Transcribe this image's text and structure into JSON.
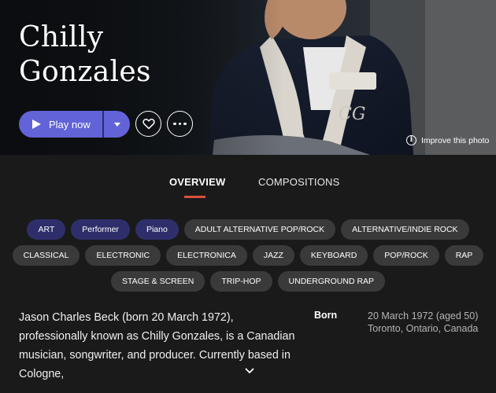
{
  "artist": {
    "name_line1": "Chilly",
    "name_line2": "Gonzales"
  },
  "actions": {
    "play_label": "Play now",
    "improve_photo": "Improve this photo"
  },
  "tabs": [
    {
      "label": "OVERVIEW",
      "active": true
    },
    {
      "label": "COMPOSITIONS",
      "active": false
    }
  ],
  "tags": {
    "row1": [
      "ART",
      "Performer",
      "Piano",
      "ADULT ALTERNATIVE POP/ROCK",
      "ALTERNATIVE/INDIE ROCK"
    ],
    "row2": [
      "CLASSICAL",
      "ELECTRONIC",
      "ELECTRONICA",
      "JAZZ",
      "KEYBOARD",
      "POP/ROCK",
      "RAP"
    ],
    "row3": [
      "STAGE & SCREEN",
      "TRIP-HOP",
      "UNDERGROUND RAP"
    ]
  },
  "bio": {
    "text": "Jason Charles Beck (born 20 March 1972), professionally known as Chilly Gonzales, is a Canadian musician, songwriter, and producer. Currently based in Cologne,"
  },
  "born": {
    "label": "Born",
    "date": "20 March 1972 (aged 50)",
    "place": "Toronto, Ontario, Canada"
  },
  "colors": {
    "accent": "#6163d6",
    "tab_underline": "#d9513b",
    "tag_accent": "#2e2f6a",
    "tag": "#3a3a3a",
    "background": "#1a1a1a"
  },
  "icons": [
    "play-icon",
    "chevron-down-icon",
    "heart-icon",
    "more-icon",
    "info-icon",
    "expand-chevron-icon"
  ]
}
